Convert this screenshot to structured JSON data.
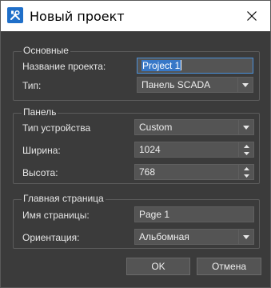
{
  "window": {
    "title": "Новый проект"
  },
  "groups": {
    "basic": {
      "title": "Основные",
      "project_name_label": "Название проекта:",
      "project_name_value": "Project 1",
      "type_label": "Тип:",
      "type_value": "Панель SCADA"
    },
    "panel": {
      "title": "Панель",
      "device_type_label": "Тип устройства",
      "device_type_value": "Custom",
      "width_label": "Ширина:",
      "width_value": "1024",
      "height_label": "Высота:",
      "height_value": "768"
    },
    "main_page": {
      "title": "Главная страница",
      "page_name_label": "Имя страницы:",
      "page_name_value": "Page 1",
      "orientation_label": "Ориентация:",
      "orientation_value": "Альбомная"
    }
  },
  "buttons": {
    "ok": "OK",
    "cancel": "Отмена"
  },
  "icons": [
    "tools-icon",
    "close-icon",
    "chevron-down-icon",
    "spin-up-icon",
    "spin-down-icon"
  ],
  "colors": {
    "background": "#3b3b3b",
    "field": "#545454",
    "selection": "#3778c8",
    "app_icon": "#1f6fc9"
  }
}
